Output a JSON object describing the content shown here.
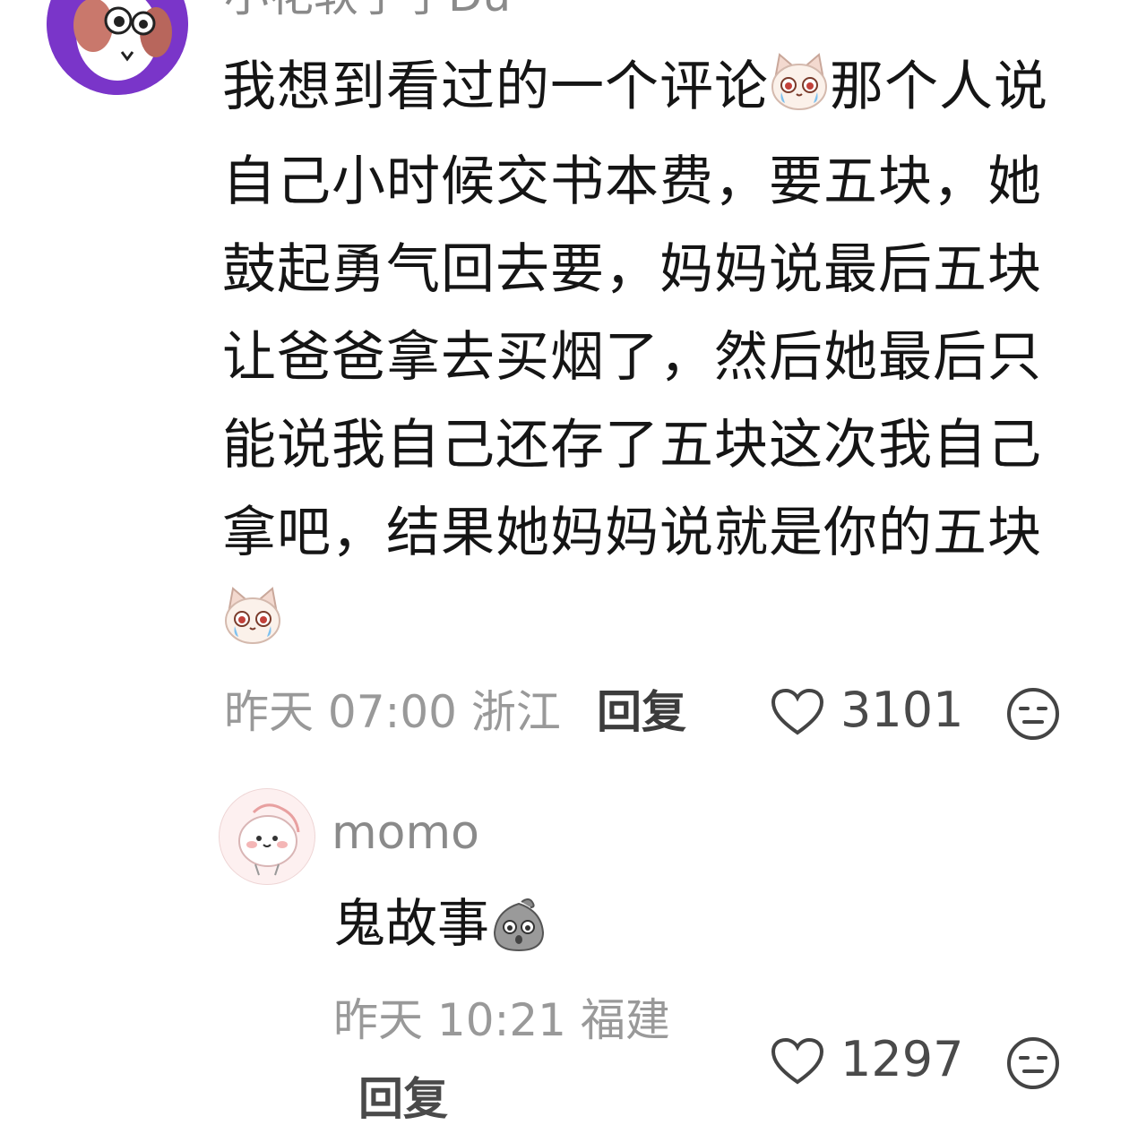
{
  "comment1": {
    "username": "小花软了了Du",
    "text_part1": "我想到看过的一个评论",
    "text_part2": "那个人说自己小时候交书本费，要五块，她鼓起勇气回去要，妈妈说最后五块让爸爸拿去买烟了，然后她最后只能说我自己还存了五块这次我自己拿吧，结果她妈妈说就是你的五块",
    "meta": "昨天 07:00 浙江",
    "reply_label": "回复",
    "like_count": "3101",
    "emoji_icon": "crying-cat-emoji"
  },
  "comment2": {
    "username": "momo",
    "text": "鬼故事",
    "emoji_icon": "gray-blob-scared-emoji",
    "meta": "昨天 10:21 福建",
    "reply_label": "回复",
    "like_count": "1297"
  },
  "colors": {
    "accent_purple": "#7a35c9",
    "text": "#151515",
    "meta": "#999999"
  }
}
